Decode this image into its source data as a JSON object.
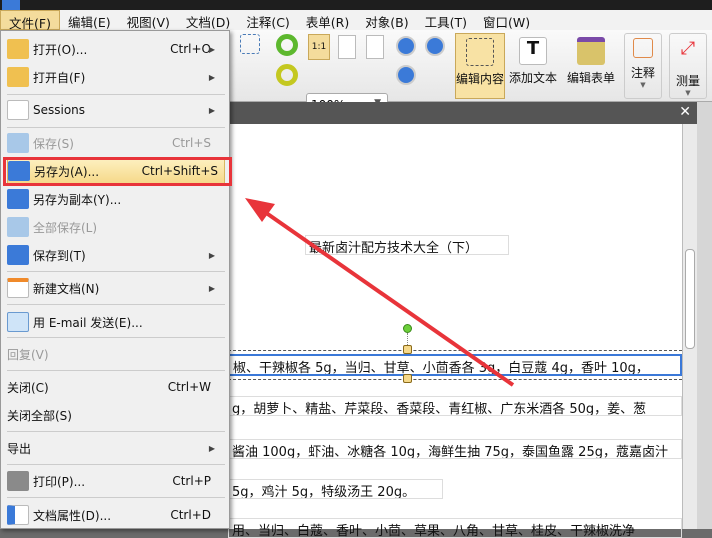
{
  "menubar": [
    "文件(F)",
    "编辑(E)",
    "视图(V)",
    "文档(D)",
    "注释(C)",
    "表单(R)",
    "对象(B)",
    "工具(T)",
    "窗口(W)"
  ],
  "toolbar": {
    "zoom": "100%",
    "edit_content": "编辑内容",
    "add_text": "添加文本",
    "edit_form": "编辑表单",
    "annotate": "注释",
    "measure": "测量",
    "actual_size": "1:1"
  },
  "file_menu": [
    {
      "label": "打开(O)...",
      "shortcut": "Ctrl+O",
      "submenu": true,
      "icon": "folder-icon"
    },
    {
      "label": "打开自(F)",
      "submenu": true,
      "icon": "folder-globe-icon"
    },
    {
      "label": "Sessions",
      "submenu": true,
      "icon": "sessions-icon"
    },
    {
      "label": "保存(S)",
      "shortcut": "Ctrl+S",
      "disabled": true,
      "icon": "save-icon"
    },
    {
      "label": "另存为(A)...",
      "shortcut": "Ctrl+Shift+S",
      "highlighted": true,
      "icon": "save-as-icon"
    },
    {
      "label": "另存为副本(Y)...",
      "icon": "save-copy-icon"
    },
    {
      "label": "全部保存(L)",
      "disabled": true,
      "icon": "save-all-icon"
    },
    {
      "label": "保存到(T)",
      "submenu": true,
      "icon": "save-to-icon"
    },
    {
      "label": "新建文档(N)",
      "submenu": true,
      "icon": "new-document-icon"
    },
    {
      "label": "用 E-mail 发送(E)...",
      "icon": "email-icon"
    },
    {
      "label": "回复(V)",
      "disabled": true
    },
    {
      "label": "关闭(C)",
      "shortcut": "Ctrl+W"
    },
    {
      "label": "关闭全部(S)"
    },
    {
      "label": "导出",
      "submenu": true
    },
    {
      "label": "打印(P)...",
      "shortcut": "Ctrl+P",
      "icon": "print-icon"
    },
    {
      "label": "文档属性(D)...",
      "shortcut": "Ctrl+D",
      "icon": "document-properties-icon"
    }
  ],
  "document": {
    "title": "最新卤汁配方技术大全（下）",
    "lines": [
      "椒、干辣椒各 5g，当归、甘草、小茴香各 3g，白豆蔻 4g，香叶 10g，",
      "g，胡萝卜、精盐、芹菜段、香菜段、青红椒、广东米酒各 50g，姜、葱",
      "酱油 100g，虾油、冰糖各 10g，海鲜生抽 75g，泰国鱼露 25g，蔻嘉卤汁",
      "5g，鸡汁 5g，特级汤王 20g。",
      "用、当归、白蔻、香叶、小茴、草果、八角、甘草、桂皮、干辣椒洗净"
    ]
  },
  "colors": {
    "highlight_box": "#e8343a",
    "selection": "#3a78d8"
  }
}
